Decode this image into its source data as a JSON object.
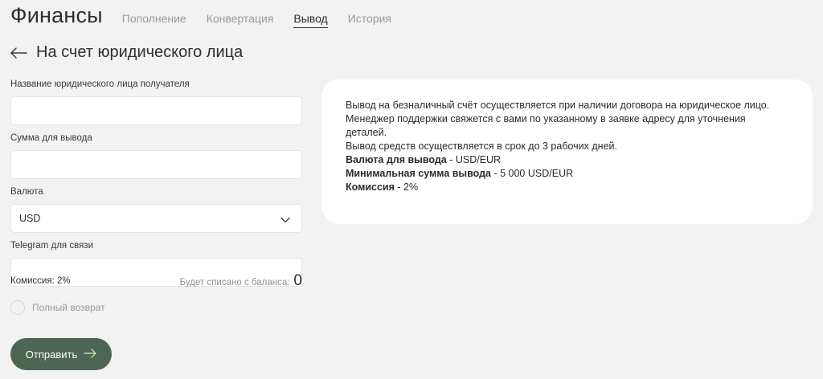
{
  "header": {
    "title": "Финансы",
    "tabs": [
      {
        "label": "Пополнение",
        "active": false
      },
      {
        "label": "Конвертация",
        "active": false
      },
      {
        "label": "Вывод",
        "active": true
      },
      {
        "label": "История",
        "active": false
      }
    ]
  },
  "subheader": {
    "back_icon": "arrow-left-icon",
    "title": "На счет юридического лица"
  },
  "form": {
    "company_name": {
      "label": "Название юридического лица получателя",
      "value": "",
      "placeholder": ""
    },
    "amount": {
      "label": "Сумма для вывода",
      "value": "",
      "placeholder": ""
    },
    "currency": {
      "label": "Валюта",
      "value": "USD"
    },
    "telegram": {
      "label": "Telegram для связи",
      "value": "",
      "placeholder": ""
    },
    "commission_text": "Комиссия: 2%",
    "balance_label": "Будет списано с баланса:",
    "balance_value": "0",
    "full_refund_label": "Полный возврат",
    "submit_label": "Отправить"
  },
  "info": {
    "line1": "Вывод на безналичный счёт осуществляется при наличии договора на юридическое лицо.",
    "line2": "Менеджер поддержки свяжется с вами по указанному в заявке адресу для уточнения деталей.",
    "line3": "Вывод средств осуществляется в срок до 3 рабочих дней.",
    "currency_key": "Валюта для вывода",
    "currency_val": " - USD/EUR",
    "min_key": "Минимальная сумма вывода",
    "min_val": " - 5 000 USD/EUR",
    "commission_key": "Комиссия",
    "commission_val": " - 2%"
  },
  "colors": {
    "background": "#f2f2f2",
    "accent": "#4d6654",
    "card": "#ffffff"
  }
}
